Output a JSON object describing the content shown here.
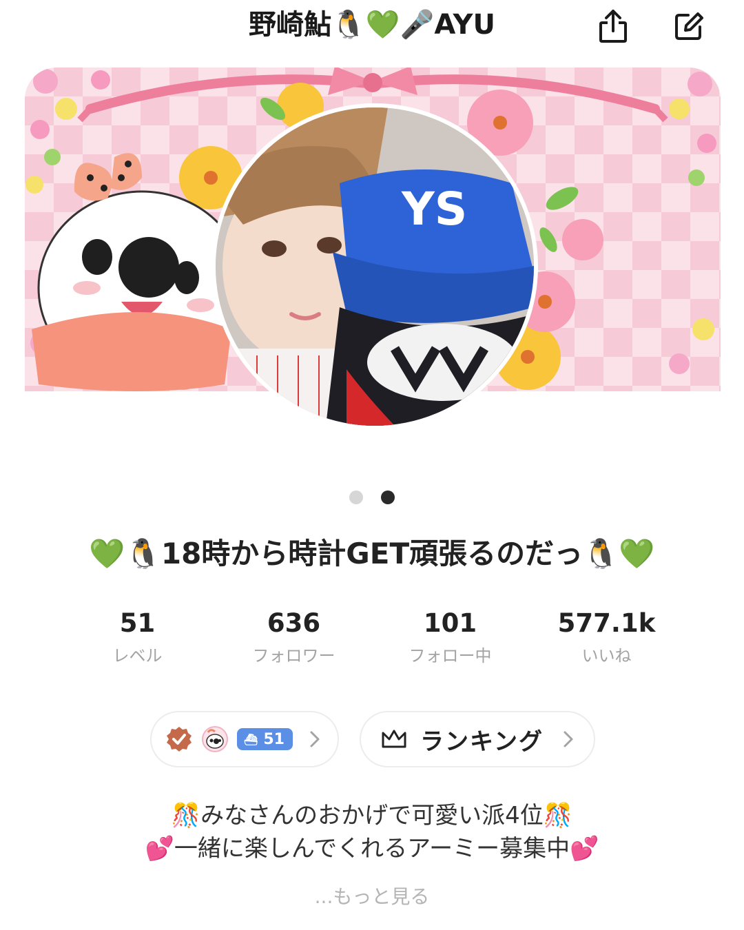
{
  "header": {
    "title": "野崎鮎🐧💚🎤AYU",
    "share_icon": "share-icon",
    "edit_icon": "edit-icon"
  },
  "banner": {
    "description_colors": {
      "checker_light": "#fbe1e8",
      "checker_dark": "#f6cad6",
      "ribbon": "#ee7f9c"
    }
  },
  "pager": {
    "total": 2,
    "active_index": 1
  },
  "status": {
    "text": "💚🐧18時から時計GET頑張るのだっ🐧💚"
  },
  "stats": [
    {
      "value": "51",
      "label": "レベル"
    },
    {
      "value": "636",
      "label": "フォロワー"
    },
    {
      "value": "101",
      "label": "フォロー中"
    },
    {
      "value": "577.1k",
      "label": "いいね"
    }
  ],
  "badges": {
    "level_value": "51",
    "icons": [
      "verified-badge-icon",
      "character-badge-icon",
      "ship-icon"
    ],
    "level_chip_color": "#5b8fe6"
  },
  "ranking": {
    "label": "ランキング",
    "icon": "crown-icon"
  },
  "bio": {
    "line1": "🎊みなさんのおかげで可愛い派4位🎊",
    "line2": "💕一緒に楽しんでくれるアーミー募集中💕"
  },
  "more": {
    "label": "...もっと見る"
  }
}
